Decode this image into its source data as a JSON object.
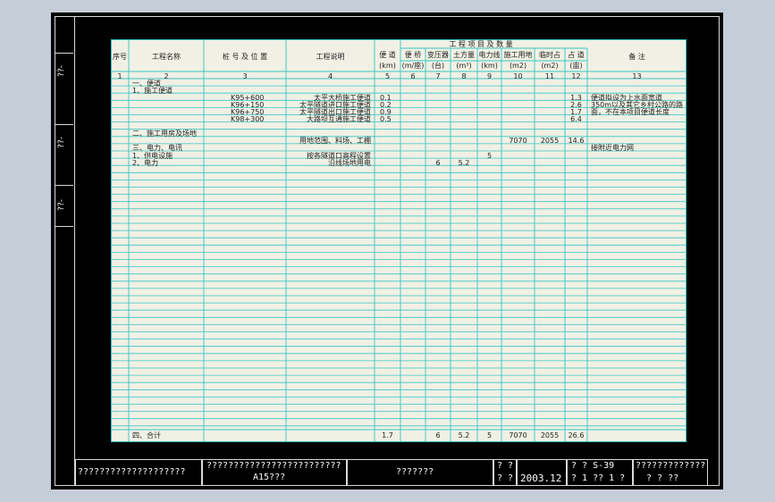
{
  "side_labels": [
    "??-",
    "??-",
    "??-"
  ],
  "table": {
    "header": {
      "seq": "序号",
      "project_name": "工程名称",
      "location": "桩 号 及 位 置",
      "description": "工程说明",
      "group_title": "工 程 项 目 及 数 量",
      "quantity_cols": [
        {
          "name": "便 道",
          "unit": "(km)"
        },
        {
          "name": "便 桥",
          "unit": "(m/座)"
        },
        {
          "name": "变压器",
          "unit": "(台)"
        },
        {
          "name": "土方量",
          "unit": "(m³)"
        },
        {
          "name": "电力线",
          "unit": "(km)"
        },
        {
          "name": "施工用地",
          "unit": "(m2)"
        },
        {
          "name": "临时占",
          "unit": "(m2)"
        },
        {
          "name": "占 道",
          "unit": "(亩)"
        }
      ],
      "remarks": "备 注"
    },
    "col_numbers": [
      "1",
      "2",
      "3",
      "4",
      "5",
      "6",
      "7",
      "8",
      "9",
      "10",
      "11",
      "12",
      "13"
    ],
    "rows": [
      {
        "name": "一、便道",
        "location": "",
        "desc": "",
        "q": [
          "",
          "",
          "",
          "",
          "",
          "",
          "",
          ""
        ],
        "remark": ""
      },
      {
        "name": "1、施工便道",
        "location": "",
        "desc": "",
        "q": [
          "",
          "",
          "",
          "",
          "",
          "",
          "",
          ""
        ],
        "remark": ""
      },
      {
        "name": "",
        "location": "K95+600",
        "desc": "太平大桥施工便道",
        "q": [
          "0.1",
          "",
          "",
          "",
          "",
          "",
          "",
          "1.3"
        ],
        "remark": "便道拟设为上水面宽道"
      },
      {
        "name": "",
        "location": "K96+150",
        "desc": "太平隧道进口施工便道",
        "q": [
          "0.2",
          "",
          "",
          "",
          "",
          "",
          "",
          "2.6"
        ],
        "remark": "350m以及其它乡村公路的路"
      },
      {
        "name": "",
        "location": "K96+750",
        "desc": "太平隧道出口施工便道",
        "q": [
          "0.9",
          "",
          "",
          "",
          "",
          "",
          "",
          "1.7"
        ],
        "remark": "面，不在本项目便道长度"
      },
      {
        "name": "",
        "location": "K98+300",
        "desc": "大路坝互通施工便道",
        "q": [
          "0.5",
          "",
          "",
          "",
          "",
          "",
          "",
          "6.4"
        ],
        "remark": ""
      },
      {
        "name": "",
        "location": "",
        "desc": "",
        "q": [
          "",
          "",
          "",
          "",
          "",
          "",
          "",
          ""
        ],
        "remark": ""
      },
      {
        "name": "二、施工用房及场地",
        "location": "",
        "desc": "",
        "q": [
          "",
          "",
          "",
          "",
          "",
          "",
          "",
          ""
        ],
        "remark": ""
      },
      {
        "name": "",
        "location": "",
        "desc": "用地范围、料场、工棚",
        "q": [
          "",
          "",
          "",
          "",
          "",
          "7070",
          "2055",
          "14.6"
        ],
        "remark": ""
      },
      {
        "name": "三、电力、电讯",
        "location": "",
        "desc": "",
        "q": [
          "",
          "",
          "",
          "",
          "",
          "",
          "",
          ""
        ],
        "remark": "接附近电力网"
      },
      {
        "name": "1、供电设施",
        "location": "",
        "desc": "按各隧道口高程设置",
        "q": [
          "",
          "",
          "",
          "",
          "5",
          "",
          "",
          ""
        ],
        "remark": ""
      },
      {
        "name": "2、电力",
        "location": "",
        "desc": "沿线场地用电",
        "q": [
          "",
          "",
          "6",
          "5.2",
          "",
          "",
          "",
          ""
        ],
        "remark": ""
      }
    ],
    "total": {
      "label": "四、合计",
      "q": [
        "1.7",
        "",
        "6",
        "5.2",
        "5",
        "7070",
        "2055",
        "26.6"
      ]
    }
  },
  "title_block": {
    "company": "????????????????????",
    "project_line1": "?????????????????????????",
    "project_line2": "A15???",
    "drawing_title": "???????",
    "label_top": "? ?",
    "label_bottom": "? ?",
    "date": "2003.12",
    "sheet_no_label": "? ? S-39",
    "sheet_count": "? 1  ?? 1 ?",
    "designer_top": "?????????????",
    "designer_bottom": "? ?   ??"
  },
  "colors": {
    "background": "#c5cdd8",
    "sheet": "#000000",
    "table_bg": "#f1f0e4",
    "grid_line": "#35c6c6",
    "frame_line": "#d8d8d8"
  }
}
